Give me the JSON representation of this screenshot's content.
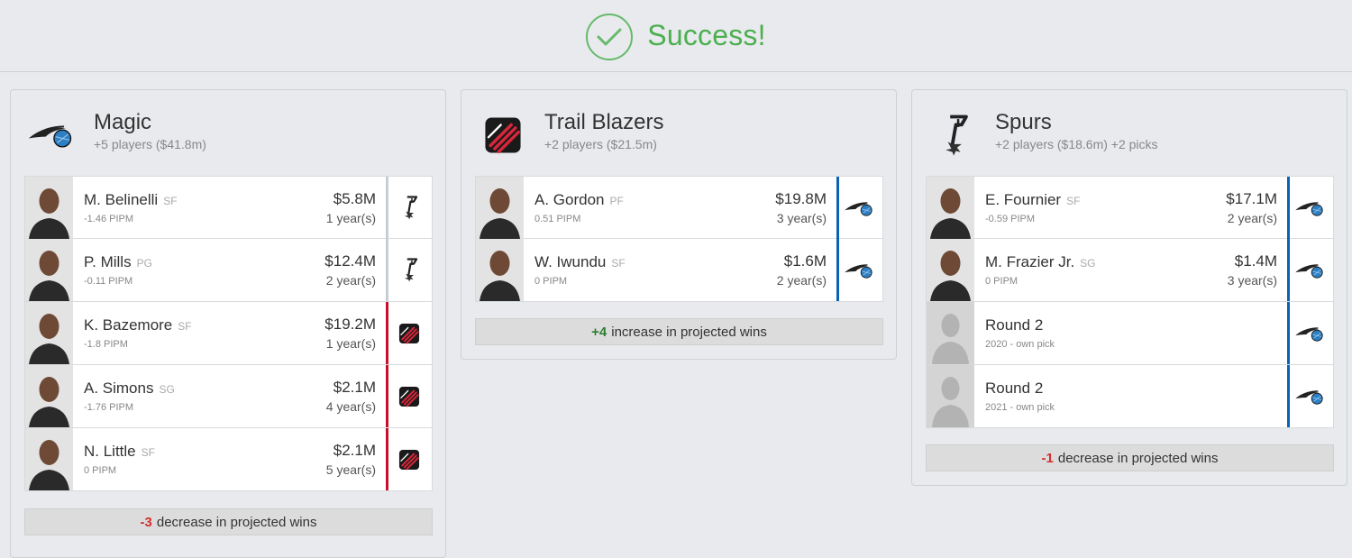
{
  "banner": {
    "text": "Success!"
  },
  "colors": {
    "magic": "#0b62b5",
    "blazers": "#c8102e",
    "spurs": "#c4ced4",
    "success": "#4caf50"
  },
  "teams": [
    {
      "name": "Magic",
      "subtitle": "+5 players ($41.8m)",
      "logo": "magic-logo",
      "players": [
        {
          "name": "M. Belinelli",
          "pos": "SF",
          "pipm": "-1.46 PIPM",
          "salary": "$5.8M",
          "years": "1 year(s)",
          "dest": "spurs"
        },
        {
          "name": "P. Mills",
          "pos": "PG",
          "pipm": "-0.11 PIPM",
          "salary": "$12.4M",
          "years": "2 year(s)",
          "dest": "spurs"
        },
        {
          "name": "K. Bazemore",
          "pos": "SF",
          "pipm": "-1.8 PIPM",
          "salary": "$19.2M",
          "years": "1 year(s)",
          "dest": "blazers"
        },
        {
          "name": "A. Simons",
          "pos": "SG",
          "pipm": "-1.76 PIPM",
          "salary": "$2.1M",
          "years": "4 year(s)",
          "dest": "blazers"
        },
        {
          "name": "N. Little",
          "pos": "SF",
          "pipm": "0 PIPM",
          "salary": "$2.1M",
          "years": "5 year(s)",
          "dest": "blazers"
        }
      ],
      "summary": {
        "num": "-3",
        "text": "decrease in projected wins"
      }
    },
    {
      "name": "Trail Blazers",
      "subtitle": "+2 players ($21.5m)",
      "logo": "blazers-logo",
      "players": [
        {
          "name": "A. Gordon",
          "pos": "PF",
          "pipm": "0.51 PIPM",
          "salary": "$19.8M",
          "years": "3 year(s)",
          "dest": "magic"
        },
        {
          "name": "W. Iwundu",
          "pos": "SF",
          "pipm": "0 PIPM",
          "salary": "$1.6M",
          "years": "2 year(s)",
          "dest": "magic"
        }
      ],
      "summary": {
        "num": "+4",
        "text": "increase in projected wins"
      }
    },
    {
      "name": "Spurs",
      "subtitle": "+2 players ($18.6m) +2 picks",
      "logo": "spurs-logo",
      "players": [
        {
          "name": "E. Fournier",
          "pos": "SF",
          "pipm": "-0.59 PIPM",
          "salary": "$17.1M",
          "years": "2 year(s)",
          "dest": "magic"
        },
        {
          "name": "M. Frazier Jr.",
          "pos": "SG",
          "pipm": "0 PIPM",
          "salary": "$1.4M",
          "years": "3 year(s)",
          "dest": "magic"
        },
        {
          "name": "Round 2",
          "pos": "",
          "pipm": "2020 - own pick",
          "salary": "",
          "years": "",
          "dest": "magic",
          "pick": true
        },
        {
          "name": "Round 2",
          "pos": "",
          "pipm": "2021 - own pick",
          "salary": "",
          "years": "",
          "dest": "magic",
          "pick": true
        }
      ],
      "summary": {
        "num": "-1",
        "text": "decrease in projected wins"
      }
    }
  ]
}
